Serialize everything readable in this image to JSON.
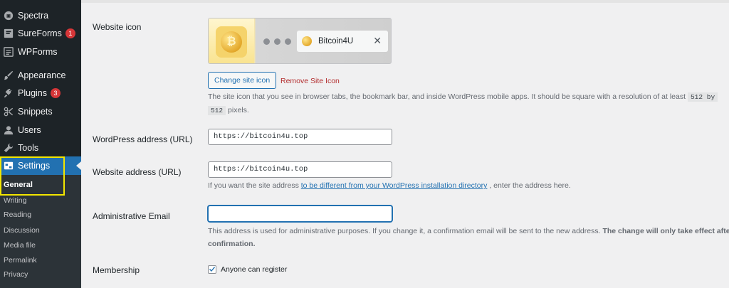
{
  "sidebar": {
    "items": [
      {
        "label": "Spectra",
        "icon": "spectra-icon"
      },
      {
        "label": "SureForms",
        "icon": "sureforms-icon",
        "badge": "1"
      },
      {
        "label": "WPForms",
        "icon": "wpforms-icon"
      },
      {
        "label": "Appearance",
        "icon": "paintbrush-icon"
      },
      {
        "label": "Plugins",
        "icon": "plug-icon",
        "badge": "3"
      },
      {
        "label": "Snippets",
        "icon": "scissors-icon"
      },
      {
        "label": "Users",
        "icon": "user-icon"
      },
      {
        "label": "Tools",
        "icon": "wrench-icon"
      },
      {
        "label": "Settings",
        "icon": "settings-icon",
        "active": true
      }
    ],
    "submenu": [
      "General",
      "Writing",
      "Reading",
      "Discussion",
      "Media file",
      "Permalink",
      "Privacy"
    ]
  },
  "settings": {
    "website_icon": {
      "label": "Website icon",
      "preview_tab_title": "Bitcoin4U",
      "preview_close": "✕",
      "change_button": "Change site icon",
      "remove_link": "Remove Site Icon",
      "desc_before": "The site icon that you see in browser tabs, the bookmark bar, and inside WordPress mobile apps. It should be square with a resolution of at least ",
      "code1": "512 by",
      "code2": "512",
      "desc_after": " pixels."
    },
    "wp_address": {
      "label": "WordPress address (URL)",
      "value": "https://bitcoin4u.top"
    },
    "site_address": {
      "label": "Website address (URL)",
      "value": "https://bitcoin4u.top",
      "help_before": "If you want the site address ",
      "help_link": "to be different from your WordPress installation directory",
      "help_after": " , enter the address here."
    },
    "admin_email": {
      "label": "Administrative Email",
      "value": "",
      "help": "This address is used for administrative purposes. If you change it, a confirmation email will be sent to the new address.",
      "help_bold": "The change will only take effect after confirmation."
    },
    "membership": {
      "label": "Membership",
      "checkbox_label": "Anyone can register",
      "checked": true
    }
  },
  "colors": {
    "sidebar_bg": "#1d2327",
    "active": "#2271b1",
    "highlight": "#f3e600",
    "badge": "#d63638"
  }
}
